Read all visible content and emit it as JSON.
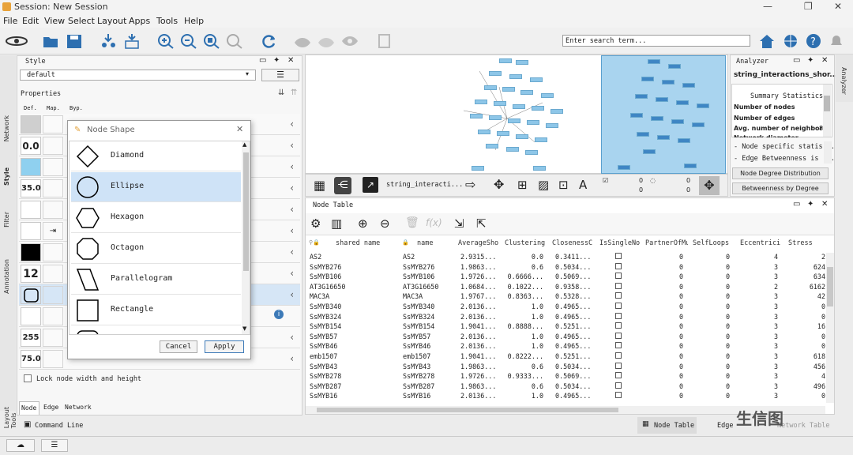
{
  "window": {
    "title": "Session: New Session"
  },
  "menu": [
    "File",
    "Edit",
    "View",
    "Select",
    "Layout",
    "Apps",
    "Tools",
    "Help"
  ],
  "toolbar": {
    "search_placeholder": "Enter search term..."
  },
  "left_tabs": {
    "network": "Network",
    "style": "Style",
    "filter": "Filter",
    "annotation": "Annotation",
    "layout_tools": "Layout Tools"
  },
  "style_panel": {
    "title": "Style",
    "style_name": "default",
    "properties_label": "Properties",
    "col_def": "Def.",
    "col_map": "Map.",
    "col_byp": "Byp.",
    "values": [
      "0.0",
      "35.0",
      "12",
      "255",
      "75.0"
    ],
    "lock_label": "Lock node width and height",
    "bottom_tabs": [
      "Node",
      "Edge",
      "Network"
    ]
  },
  "dialog": {
    "title": "Node Shape",
    "shapes": [
      "Diamond",
      "Ellipse",
      "Hexagon",
      "Octagon",
      "Parallelogram",
      "Rectangle"
    ],
    "selected": "Ellipse",
    "cancel": "Cancel",
    "apply": "Apply"
  },
  "network_view": {
    "network_name": "string_interacti...",
    "zero_a": "0",
    "zero_b": "0",
    "zero_c": "0",
    "zero_d": "0"
  },
  "analyzer": {
    "title": "Analyzer",
    "network": "string_interactions_shor...",
    "summary_title": "Summary Statistics",
    "rows": [
      "Number of nodes",
      "Number of edges",
      "Avg. number of neighbors",
      "Network diameter"
    ],
    "avg_value": "8",
    "links": [
      "- Node specific statis...",
      "- Edge Betweenness is ..."
    ],
    "btn1": "Node Degree Distribution",
    "btn2": "Betweenness by Degree",
    "side_label": "Analyzer"
  },
  "table": {
    "title": "Node Table",
    "columns": [
      "shared name",
      "name",
      "AverageSho",
      "Clustering",
      "ClosenessC",
      "IsSingleNo",
      "PartnerOfMu",
      "SelfLoops",
      "Eccentrici",
      "Stress"
    ],
    "rows": [
      [
        "AS2",
        "AS2",
        "2.9315...",
        "0.0",
        "0.3411...",
        "0",
        "0",
        "4",
        "2"
      ],
      [
        "SsMYB276",
        "SsMYB276",
        "1.9863...",
        "0.6",
        "0.5034...",
        "0",
        "0",
        "3",
        "624"
      ],
      [
        "SsMYB106",
        "SsMYB106",
        "1.9726...",
        "0.6666...",
        "0.5069...",
        "0",
        "0",
        "3",
        "634"
      ],
      [
        "AT3G16650",
        "AT3G16650",
        "1.0684...",
        "0.1022...",
        "0.9358...",
        "0",
        "0",
        "2",
        "6162"
      ],
      [
        "MAC3A",
        "MAC3A",
        "1.9767...",
        "0.8363...",
        "0.5328...",
        "0",
        "0",
        "3",
        "42"
      ],
      [
        "SsMYB340",
        "SsMYB340",
        "2.0136...",
        "1.0",
        "0.4965...",
        "0",
        "0",
        "3",
        "0"
      ],
      [
        "SsMYB324",
        "SsMYB324",
        "2.0136...",
        "1.0",
        "0.4965...",
        "0",
        "0",
        "3",
        "0"
      ],
      [
        "SsMYB154",
        "SsMYB154",
        "1.9041...",
        "0.8888...",
        "0.5251...",
        "0",
        "0",
        "3",
        "16"
      ],
      [
        "SsMYB57",
        "SsMYB57",
        "2.0136...",
        "1.0",
        "0.4965...",
        "0",
        "0",
        "3",
        "0"
      ],
      [
        "SsMYB46",
        "SsMYB46",
        "2.0136...",
        "1.0",
        "0.4965...",
        "0",
        "0",
        "3",
        "0"
      ],
      [
        "emb1507",
        "emb1507",
        "1.9041...",
        "0.8222...",
        "0.5251...",
        "0",
        "0",
        "3",
        "618"
      ],
      [
        "SsMYB43",
        "SsMYB43",
        "1.9863...",
        "0.6",
        "0.5034...",
        "0",
        "0",
        "3",
        "456"
      ],
      [
        "SsMYB278",
        "SsMYB278",
        "1.9726...",
        "0.9333...",
        "0.5069...",
        "0",
        "0",
        "3",
        "4"
      ],
      [
        "SsMYB287",
        "SsMYB287",
        "1.9863...",
        "0.6",
        "0.5034...",
        "0",
        "0",
        "3",
        "496"
      ],
      [
        "SsMYB16",
        "SsMYB16",
        "2.0136...",
        "1.0",
        "0.4965...",
        "0",
        "0",
        "3",
        "0"
      ]
    ]
  },
  "bottom": {
    "command_line": "Command Line",
    "node_table": "Node Table",
    "edge": "Edge",
    "network_table": "Network Table",
    "watermark": "生信图"
  }
}
